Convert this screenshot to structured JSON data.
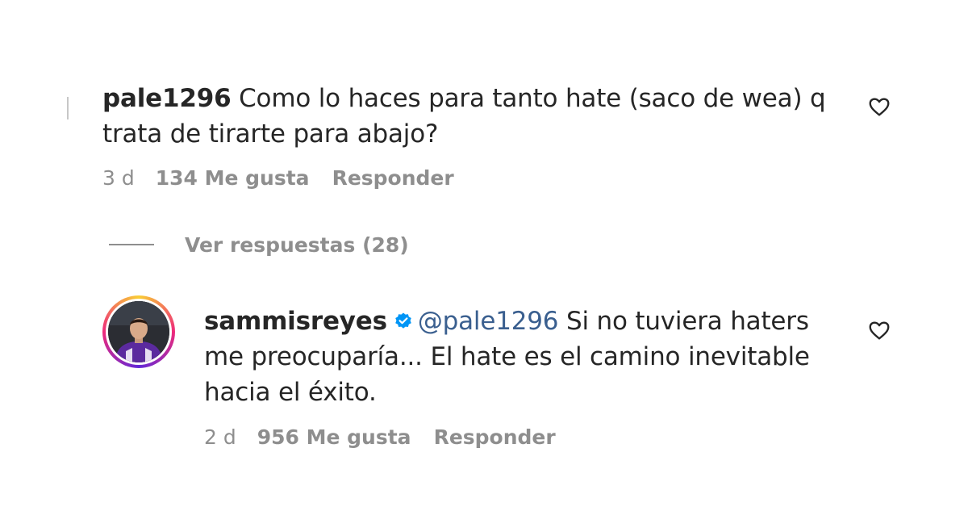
{
  "comments": [
    {
      "username": "pale1296",
      "text": "Como lo haces para tanto hate (saco de wea) q trata de tirarte para abajo?",
      "time": "3 d",
      "likes": "134 Me gusta",
      "reply_label": "Responder",
      "view_replies": "Ver respuestas (28)"
    },
    {
      "username": "sammisreyes",
      "verified": true,
      "mention": "@pale1296",
      "text": "Si no tuviera haters me preocuparía... El hate es el camino inevitable hacia el éxito.",
      "time": "2 d",
      "likes": "956 Me gusta",
      "reply_label": "Responder"
    }
  ],
  "colors": {
    "text": "#262626",
    "muted": "#8e8e8e",
    "mention": "#3a5f8f",
    "verified": "#0095f6"
  },
  "icons": {
    "like": "heart-outline-icon",
    "verified": "verified-badge-icon"
  }
}
